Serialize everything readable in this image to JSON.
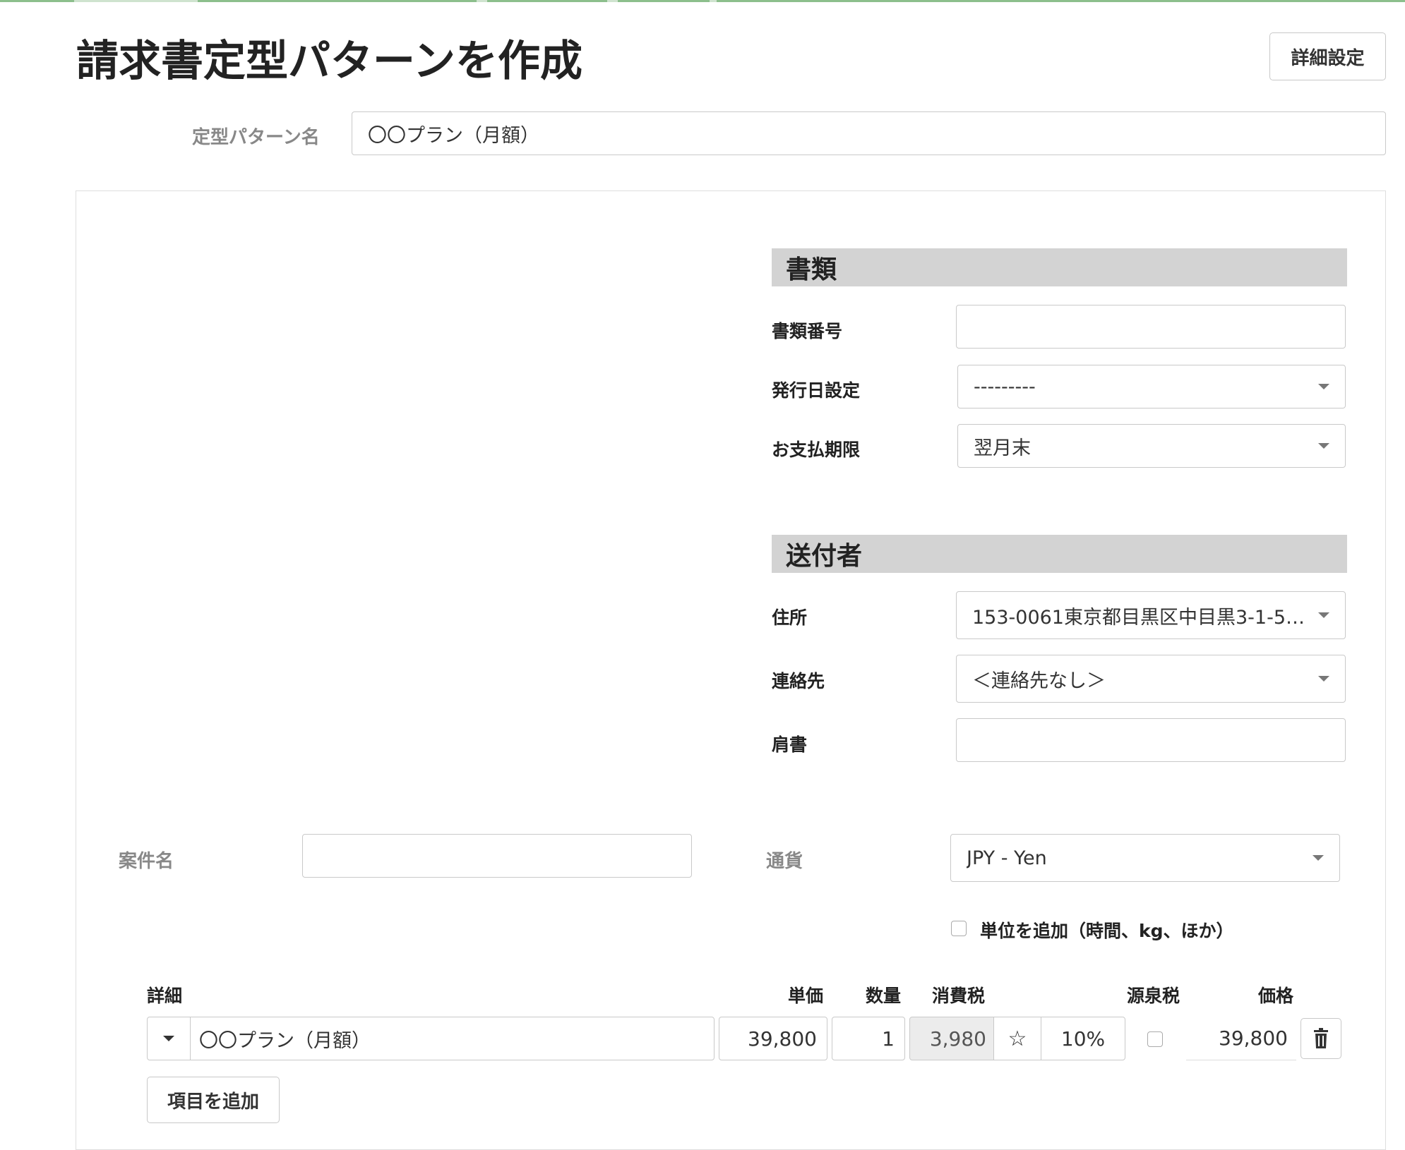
{
  "header": {
    "title": "請求書定型パターンを作成",
    "detail_settings_button": "詳細設定"
  },
  "pattern_name": {
    "label": "定型パターン名",
    "value": "〇〇プラン（月額）"
  },
  "document_section": {
    "heading": "書類",
    "doc_number_label": "書類番号",
    "doc_number_value": "",
    "issue_date_label": "発行日設定",
    "issue_date_value": "---------",
    "due_label": "お支払期限",
    "due_value": "翌月末"
  },
  "sender_section": {
    "heading": "送付者",
    "address_label": "住所",
    "address_value": "153-0061東京都目黒区中目黒3-1-5…",
    "contact_label": "連絡先",
    "contact_value": "＜連絡先なし＞",
    "title_label": "肩書",
    "title_value": ""
  },
  "project": {
    "label": "案件名",
    "value": ""
  },
  "currency": {
    "label": "通貨",
    "value": "JPY - Yen"
  },
  "unit_option": {
    "label": "単位を追加（時間、kg、ほか）",
    "checked": false
  },
  "line_items": {
    "headers": {
      "detail": "詳細",
      "unit_price": "単価",
      "quantity": "数量",
      "tax": "消費税",
      "withholding": "源泉税",
      "price": "価格"
    },
    "rows": [
      {
        "description": "〇〇プラン（月額）",
        "unit_price": "39,800",
        "quantity": "1",
        "tax_amount": "3,980",
        "tax_icon": "star-icon",
        "tax_rate": "10%",
        "withholding": false,
        "price": "39,800"
      }
    ],
    "add_button": "項目を追加"
  }
}
